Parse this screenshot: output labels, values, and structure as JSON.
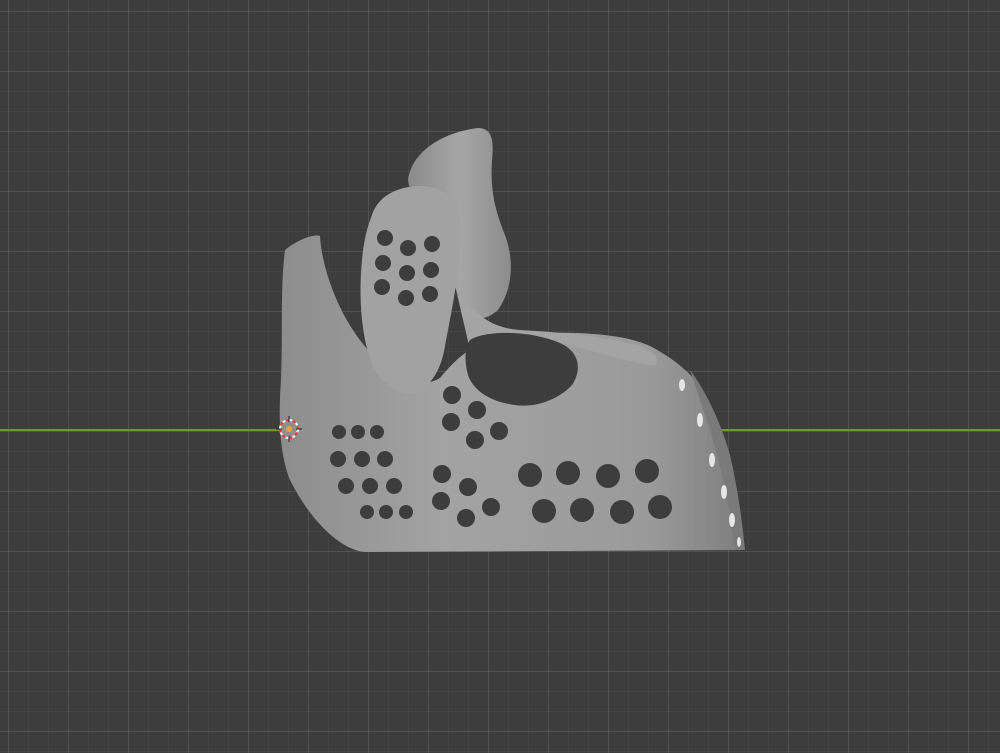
{
  "viewport": {
    "background_color": "#3d3d3d",
    "grid_color": "#4a4a4a",
    "x_axis_color": "#6e9a2f"
  },
  "model": {
    "surface_color": "#9b9b9b",
    "shadow_color": "#6f6f6f",
    "hole_color": "#3d3d3d"
  },
  "cursor": {
    "icon": "3d-cursor-icon",
    "ring_colors": [
      "#ffffff",
      "#e04040"
    ],
    "center_color": "#f0a030"
  }
}
